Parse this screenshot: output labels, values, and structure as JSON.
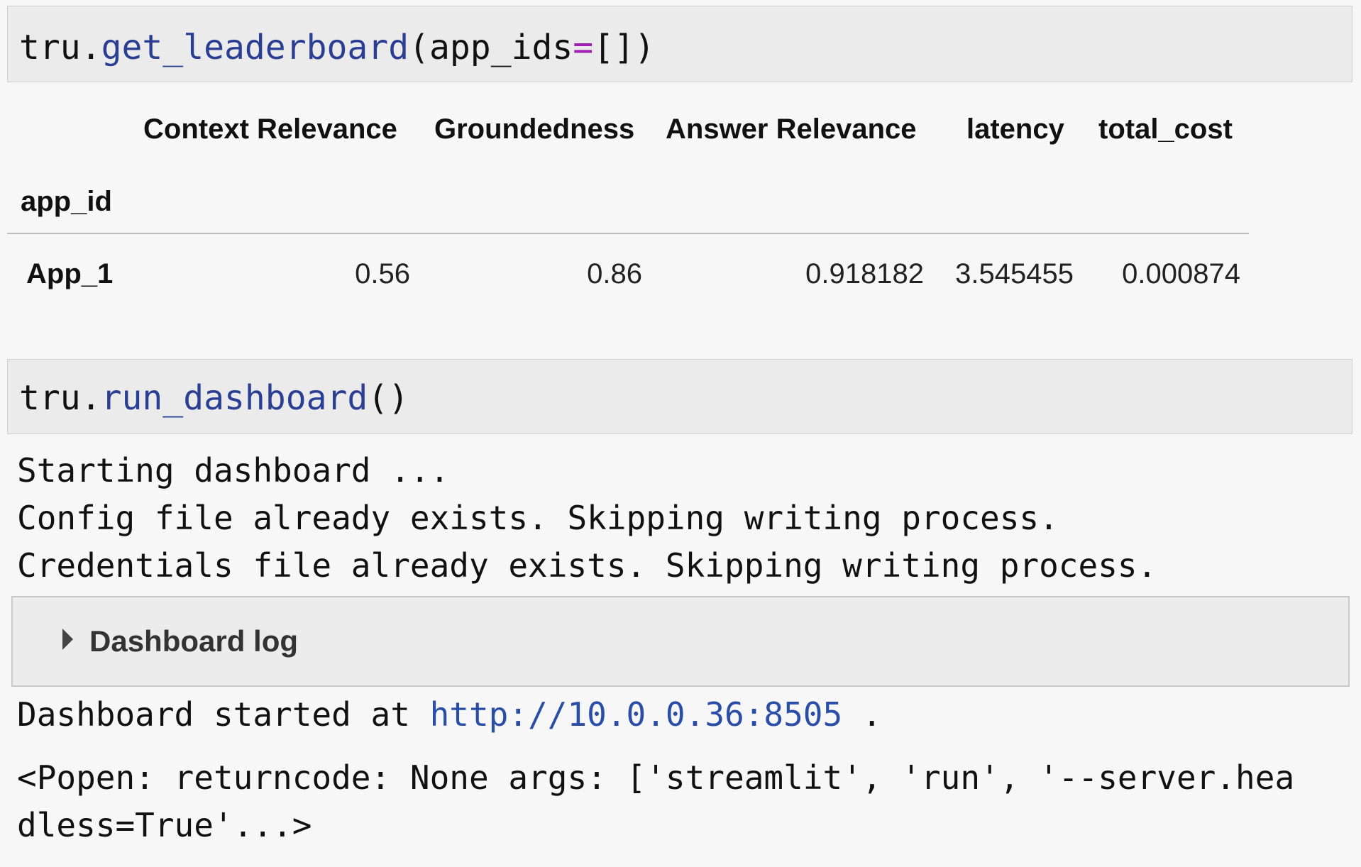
{
  "cells": {
    "leaderboard_call": {
      "object": "tru",
      "dot": ".",
      "method": "get_leaderboard",
      "paren_open": "(",
      "arg_name": "app_ids",
      "equals": "=",
      "arg_value": "[]",
      "paren_close": ")"
    },
    "dashboard_call": {
      "object": "tru",
      "dot": ".",
      "method": "run_dashboard",
      "parens": "()"
    }
  },
  "leaderboard": {
    "columns": [
      "Context Relevance",
      "Groundedness",
      "Answer Relevance",
      "latency",
      "total_cost"
    ],
    "index_name": "app_id",
    "rows": [
      {
        "app_id": "App_1",
        "values": [
          "0.56",
          "0.86",
          "0.918182",
          "3.545455",
          "0.000874"
        ]
      }
    ]
  },
  "output": {
    "lines": [
      "Starting dashboard ...",
      "Config file already exists. Skipping writing process.",
      "Credentials file already exists. Skipping writing process."
    ],
    "dashboard_log_label": "Dashboard log",
    "started_prefix": "Dashboard started at ",
    "started_url": "http://10.0.0.36:8505",
    "started_suffix": " .",
    "popen_line_1": "<Popen: returncode: None args: ['streamlit', 'run', '--server.hea",
    "popen_line_2": "dless=True'...>"
  },
  "colors": {
    "method": "#2a3f93",
    "operator": "#a01fb3",
    "link": "#2a4ea8"
  }
}
